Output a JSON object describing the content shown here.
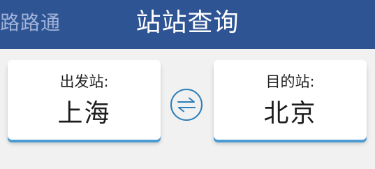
{
  "header": {
    "back_label": "路路通",
    "title": "站站查询"
  },
  "from_station": {
    "label": "出发站:",
    "name": "上海"
  },
  "to_station": {
    "label": "目的站:",
    "name": "北京"
  },
  "swap_button": {
    "icon": "swap-arrows-icon"
  },
  "colors": {
    "header_bg": "#2f5494",
    "accent": "#4c9bd3",
    "swap_icon": "#2c7fb8",
    "page_bg": "#f1f1f1"
  }
}
